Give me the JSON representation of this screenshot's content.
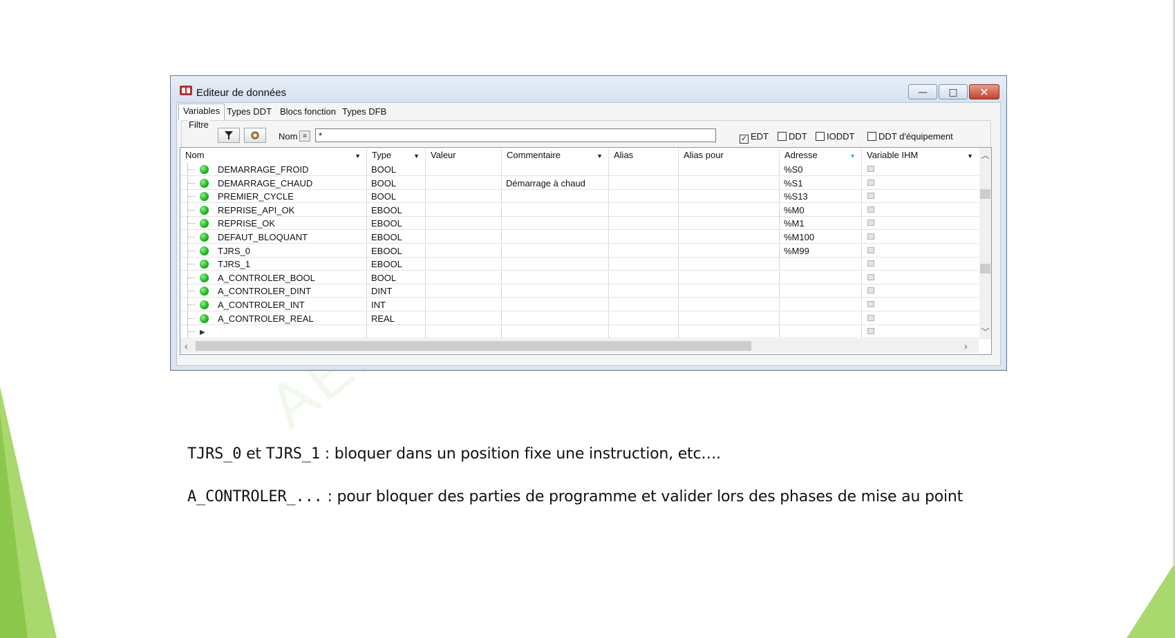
{
  "window": {
    "title": "Editeur de données",
    "minimize_glyph": "—",
    "maximize_glyph": "□",
    "close_glyph": "✕"
  },
  "tabs": [
    "Variables",
    "Types DDT",
    "Blocs fonction",
    "Types DFB"
  ],
  "filter": {
    "label": "Filtre",
    "name_label": "Nom",
    "eq_label": "=",
    "name_value": "*",
    "checkboxes": [
      {
        "label": "EDT",
        "checked": true
      },
      {
        "label": "DDT",
        "checked": false
      },
      {
        "label": "IODDT",
        "checked": false
      },
      {
        "label": "DDT d'équipement",
        "checked": false
      }
    ]
  },
  "columns": [
    "Nom",
    "Type",
    "Valeur",
    "Commentaire",
    "Alias",
    "Alias pour",
    "Adresse",
    "Variable IHM"
  ],
  "rows": [
    {
      "nom": "DEMARRAGE_FROID",
      "type": "BOOL",
      "valeur": "",
      "commentaire": "",
      "alias": "",
      "alias_pour": "",
      "adresse": "%S0"
    },
    {
      "nom": "DEMARRAGE_CHAUD",
      "type": "BOOL",
      "valeur": "",
      "commentaire": "Démarrage à chaud",
      "alias": "",
      "alias_pour": "",
      "adresse": "%S1"
    },
    {
      "nom": "PREMIER_CYCLE",
      "type": "BOOL",
      "valeur": "",
      "commentaire": "",
      "alias": "",
      "alias_pour": "",
      "adresse": "%S13"
    },
    {
      "nom": "REPRISE_API_OK",
      "type": "EBOOL",
      "valeur": "",
      "commentaire": "",
      "alias": "",
      "alias_pour": "",
      "adresse": "%M0"
    },
    {
      "nom": "REPRISE_OK",
      "type": "EBOOL",
      "valeur": "",
      "commentaire": "",
      "alias": "",
      "alias_pour": "",
      "adresse": "%M1"
    },
    {
      "nom": "DEFAUT_BLOQUANT",
      "type": "EBOOL",
      "valeur": "",
      "commentaire": "",
      "alias": "",
      "alias_pour": "",
      "adresse": "%M100"
    },
    {
      "nom": "TJRS_0",
      "type": "EBOOL",
      "valeur": "",
      "commentaire": "",
      "alias": "",
      "alias_pour": "",
      "adresse": "%M99"
    },
    {
      "nom": "TJRS_1",
      "type": "EBOOL",
      "valeur": "",
      "commentaire": "",
      "alias": "",
      "alias_pour": "",
      "adresse": ""
    },
    {
      "nom": "A_CONTROLER_BOOL",
      "type": "BOOL",
      "valeur": "",
      "commentaire": "",
      "alias": "",
      "alias_pour": "",
      "adresse": ""
    },
    {
      "nom": "A_CONTROLER_DINT",
      "type": "DINT",
      "valeur": "",
      "commentaire": "",
      "alias": "",
      "alias_pour": "",
      "adresse": ""
    },
    {
      "nom": "A_CONTROLER_INT",
      "type": "INT",
      "valeur": "",
      "commentaire": "",
      "alias": "",
      "alias_pour": "",
      "adresse": ""
    },
    {
      "nom": "A_CONTROLER_REAL",
      "type": "REAL",
      "valeur": "",
      "commentaire": "",
      "alias": "",
      "alias_pour": "",
      "adresse": ""
    }
  ],
  "notes": [
    {
      "code1": "TJRS_0",
      "mid": " et ",
      "code2": "TJRS_1",
      "text": " : bloquer dans un position fixe une instruction, etc…."
    },
    {
      "code1": "A_CONTROLER_...",
      "mid": "",
      "code2": "",
      "text": " : pour bloquer des parties de programme et valider lors des phases de mise au point"
    }
  ],
  "watermark": "AELI FORMA",
  "colors": {
    "accent_green": "#7dc142",
    "status_dot": "#19b41a",
    "close_button": "#c1432d"
  }
}
